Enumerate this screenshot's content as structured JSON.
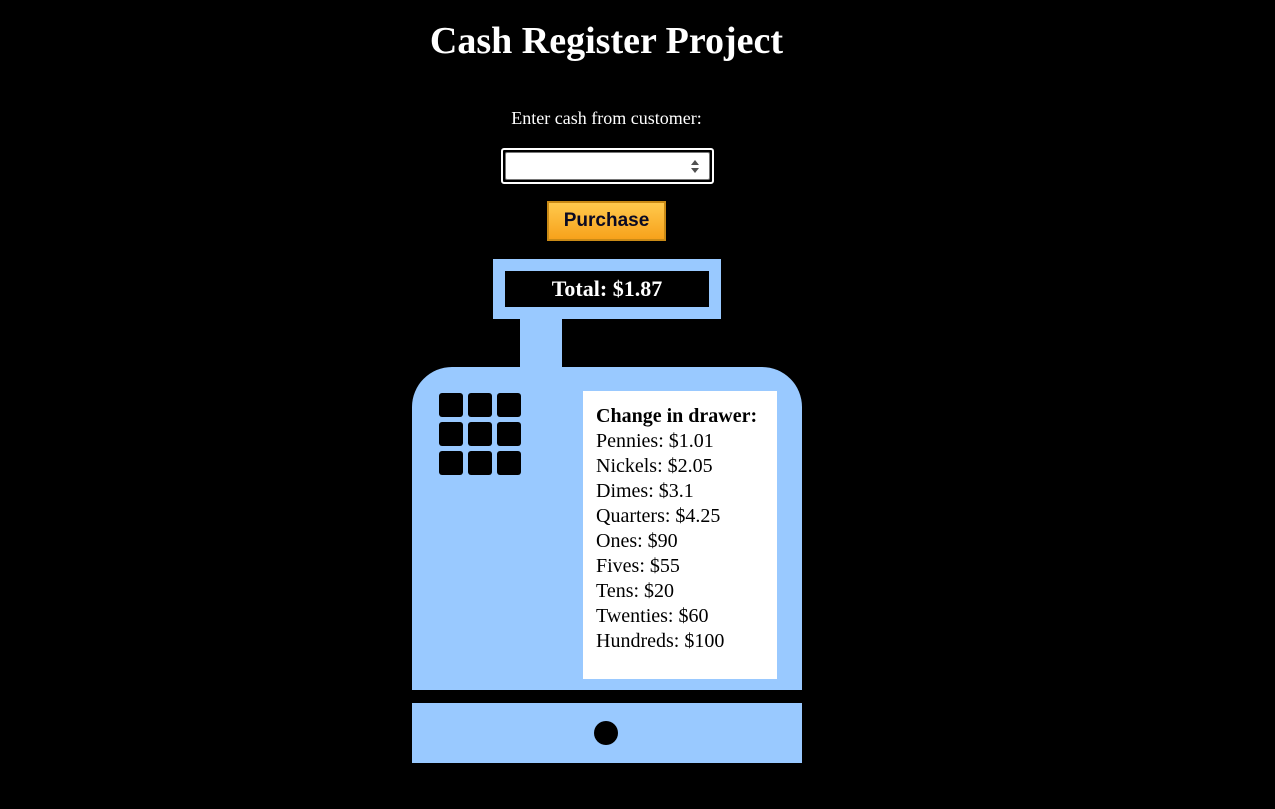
{
  "page": {
    "title": "Cash Register Project"
  },
  "form": {
    "cash_label": "Enter cash from customer:",
    "cash_value": "",
    "purchase_label": "Purchase"
  },
  "display": {
    "total_text": "Total: $1.87"
  },
  "drawer": {
    "heading": "Change in drawer:",
    "items": [
      {
        "text": "Pennies: $1.01"
      },
      {
        "text": "Nickels: $2.05"
      },
      {
        "text": "Dimes: $3.1"
      },
      {
        "text": "Quarters: $4.25"
      },
      {
        "text": "Ones: $90"
      },
      {
        "text": "Fives: $55"
      },
      {
        "text": "Tens: $20"
      },
      {
        "text": "Twenties: $60"
      },
      {
        "text": "Hundreds: $100"
      }
    ]
  },
  "colors": {
    "background": "#000000",
    "register": "#99c9ff",
    "button_top": "#ffc94d",
    "button_bottom": "#f7a21b",
    "text_light": "#ffffff"
  },
  "icons": {
    "keypad": "keypad-key-icon",
    "drawer_button": "drawer-button-icon",
    "spinner": "number-spinner-icon"
  }
}
